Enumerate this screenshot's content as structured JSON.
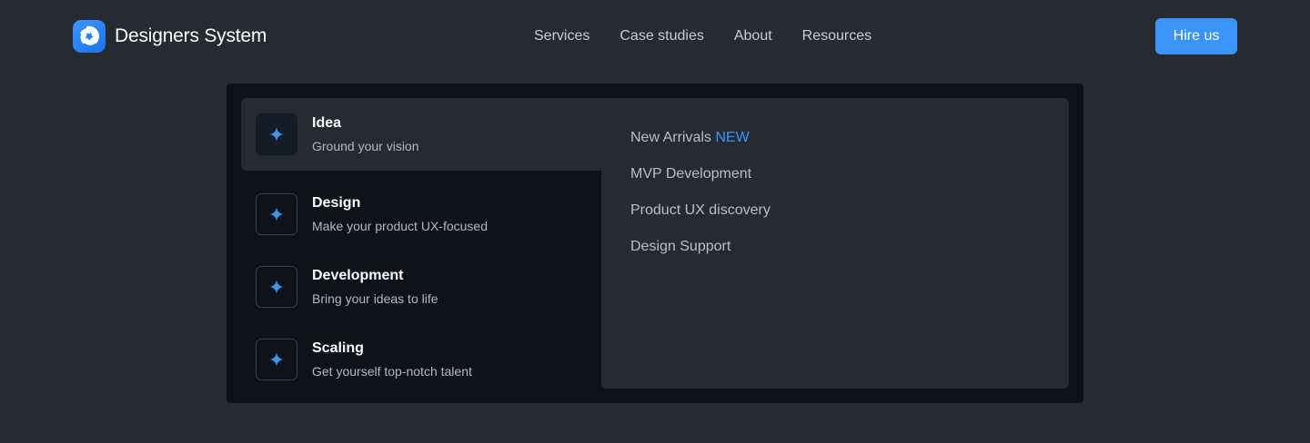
{
  "brand": {
    "name": "Designers System",
    "logo_icon": "aperture-swirl-icon",
    "accent_color": "#3b95f8"
  },
  "nav": {
    "links": [
      "Services",
      "Case studies",
      "About",
      "Resources"
    ],
    "cta_label": "Hire us"
  },
  "mega_menu": {
    "items": [
      {
        "title": "Idea",
        "subtitle": "Ground your vision",
        "icon": "sparkle-icon",
        "active": true
      },
      {
        "title": "Design",
        "subtitle": "Make your product UX-focused",
        "icon": "sparkle-icon",
        "active": false
      },
      {
        "title": "Development",
        "subtitle": "Bring your ideas to life",
        "icon": "sparkle-icon",
        "active": false
      },
      {
        "title": "Scaling",
        "subtitle": "Get yourself top-notch talent",
        "icon": "sparkle-icon",
        "active": false
      }
    ],
    "sub_links": [
      {
        "label": "New Arrivals",
        "badge": "NEW"
      },
      {
        "label": "MVP Development"
      },
      {
        "label": "Product UX discovery"
      },
      {
        "label": "Design Support"
      }
    ]
  }
}
